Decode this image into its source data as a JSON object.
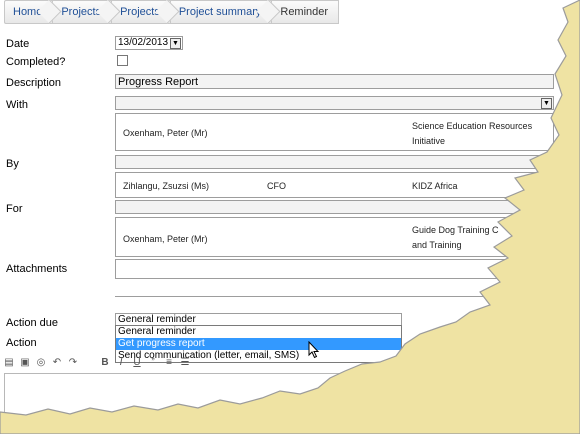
{
  "breadcrumbs": [
    "Home",
    "Projects",
    "Projects",
    "Project summary",
    "Reminder"
  ],
  "labels": {
    "date": "Date",
    "completed": "Completed?",
    "description": "Description",
    "with": "With",
    "by": "By",
    "for": "For",
    "attachments": "Attachments",
    "action_due": "Action due",
    "action": "Action"
  },
  "date_value": "13/02/2013",
  "description_value": "Progress Report",
  "with_row": {
    "name": "Oxenham, Peter (Mr)",
    "org_line1": "Science Education Resources",
    "org_line2": "Initiative"
  },
  "by_row": {
    "name": "Zihlangu, Zsuzsi (Ms)",
    "role": "CFO",
    "org": "KIDZ Africa"
  },
  "for_row": {
    "name": "Oxenham, Peter (Mr)",
    "org_line1": "Guide Dog Training C",
    "org_line2": "and Training"
  },
  "action_due_value": "General reminder",
  "dropdown_options": [
    "General reminder",
    "Get progress report",
    "Send communication (letter, email, SMS)"
  ],
  "dropdown_selected_index": 1,
  "colors": {
    "link": "#1f4f96",
    "highlight": "#3399ff",
    "torn_paper": "#efe3a3"
  }
}
